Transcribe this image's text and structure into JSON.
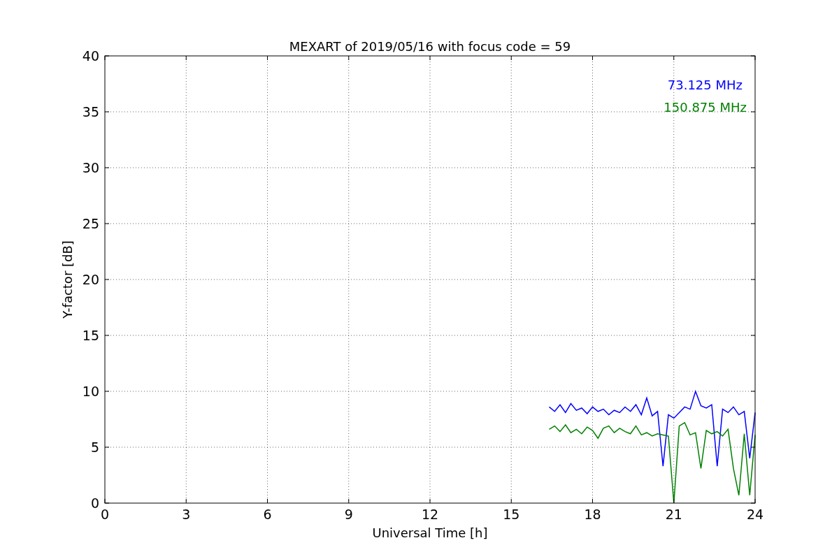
{
  "figure": {
    "chart_data": {
      "type": "line",
      "title": "MEXART of 2019/05/16 with focus code = 59",
      "xlabel": "Universal Time [h]",
      "ylabel": "Y-factor [dB]",
      "x": [
        16.4,
        16.6,
        16.8,
        17.0,
        17.2,
        17.4,
        17.6,
        17.8,
        18.0,
        18.2,
        18.4,
        18.6,
        18.8,
        19.0,
        19.2,
        19.4,
        19.6,
        19.8,
        20.0,
        20.2,
        20.4,
        20.6,
        20.8,
        21.0,
        21.2,
        21.4,
        21.6,
        21.8,
        22.0,
        22.2,
        22.4,
        22.6,
        22.8,
        23.0,
        23.2,
        23.4,
        23.6,
        23.8,
        24.0
      ],
      "series": [
        {
          "name": "73.125 MHz",
          "color": "#0000ff",
          "values": [
            8.6,
            8.2,
            8.8,
            8.1,
            8.9,
            8.3,
            8.5,
            8.0,
            8.6,
            8.2,
            8.4,
            7.9,
            8.3,
            8.1,
            8.6,
            8.2,
            8.8,
            7.9,
            9.4,
            7.8,
            8.2,
            3.3,
            7.9,
            7.6,
            8.1,
            8.6,
            8.4,
            10.0,
            8.7,
            8.5,
            8.8,
            3.3,
            8.4,
            8.1,
            8.6,
            7.9,
            8.2,
            4.0,
            8.1
          ]
        },
        {
          "name": "150.875 MHz",
          "color": "#008000",
          "values": [
            6.6,
            6.9,
            6.4,
            7.0,
            6.3,
            6.6,
            6.2,
            6.8,
            6.5,
            5.8,
            6.7,
            6.9,
            6.3,
            6.7,
            6.4,
            6.2,
            6.9,
            6.1,
            6.3,
            6.0,
            6.2,
            6.1,
            6.0,
            0.0,
            6.9,
            7.2,
            6.1,
            6.3,
            3.1,
            6.5,
            6.2,
            6.4,
            6.0,
            6.6,
            3.1,
            0.7,
            6.2,
            0.7,
            6.1
          ]
        }
      ],
      "grid": true,
      "xlim": [
        0,
        24
      ],
      "ylim": [
        0,
        40
      ],
      "xticks": [
        0,
        3,
        6,
        9,
        12,
        15,
        18,
        21,
        24
      ],
      "yticks": [
        0,
        5,
        10,
        15,
        20,
        25,
        30,
        35,
        40
      ]
    }
  }
}
